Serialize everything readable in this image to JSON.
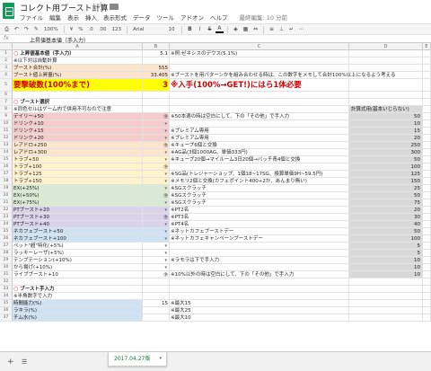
{
  "doc_title": "コレクト用ブースト計算",
  "menu": [
    "ファイル",
    "編集",
    "表示",
    "挿入",
    "表示形式",
    "データ",
    "ツール",
    "アドオン",
    "ヘルプ"
  ],
  "last_edit": "最終編集: 10 分前",
  "toolbar": {
    "zoom": "100%",
    "currency": "¥",
    "percent": "%",
    "decimals1": ".0",
    "decimals2": ".00",
    "number_format": "123",
    "font": "Arial",
    "font_size": "10",
    "bold": "B",
    "italic": "I",
    "strike": "S",
    "color_a": "A"
  },
  "formula_bar": {
    "fx": "fx",
    "content": "上昇値基本値（手入力）"
  },
  "columns": [
    "A",
    "B",
    "C",
    "D",
    "E"
  ],
  "rows": [
    {
      "n": "1",
      "a": "上昇値基本値（手入力）",
      "b": "5.1",
      "c": "※例:ゼネシスのデウス(5.1%)",
      "d": "",
      "type": "head",
      "a_bg": "#ffffff",
      "marker": "○"
    },
    {
      "n": "2",
      "a": "※以下対は自動計算",
      "b": "",
      "c": "",
      "d": "",
      "a_bg": "#ffffff"
    },
    {
      "n": "3",
      "a": "ブースト合計(%)",
      "b": "555",
      "c": "",
      "d": "",
      "a_bg": "#fce5cd",
      "b_bg": "#fce5cd"
    },
    {
      "n": "4",
      "a": "ブースト値上昇量(%)",
      "b": "33.405",
      "c": "※ブーストを用パターンかを組み合わせる時は、この数字をメモして合計100%以上になるよう考える",
      "d": "",
      "a_bg": "#fce5cd",
      "b_bg": "#fce5cd"
    },
    {
      "n": "5",
      "a": "要撃破数(100%まで)",
      "b": "3",
      "c": "※入手(100%→GET!)にはら1体必要",
      "d": "",
      "tall": true,
      "big": true,
      "a_bg": "#ffff00",
      "b_bg": "#ffff00"
    },
    {
      "n": "6",
      "a": "",
      "b": "",
      "c": "",
      "d": ""
    },
    {
      "n": "7",
      "a": "ブースト選択",
      "b": "",
      "c": "",
      "d": "",
      "type": "head",
      "marker": "○"
    },
    {
      "n": "8",
      "a": "※同色セルはゲーム内で併用不可なので注意",
      "b": "",
      "c": "",
      "d": "計算式用(基本いじらない)",
      "d_bg": "#d9d9d9",
      "d_align": "left"
    },
    {
      "n": "9",
      "a": "デイリー+50",
      "b": "○",
      "c": "※50本適の時は空白にして、下の「その他」で手入力",
      "d": "50",
      "a_bg": "#f4cccc",
      "b_bg": "#f4cccc",
      "dd": true,
      "d_bg": "#d9d9d9"
    },
    {
      "n": "10",
      "a": "ドリンク+10",
      "b": "",
      "c": "",
      "d": "10",
      "a_bg": "#f4cccc",
      "b_bg": "#f4cccc",
      "dd": true,
      "d_bg": "#d9d9d9"
    },
    {
      "n": "11",
      "a": "ドリンク+15",
      "b": "",
      "c": "※プレミアム専用",
      "d": "15",
      "a_bg": "#f4cccc",
      "b_bg": "#f4cccc",
      "dd": true,
      "d_bg": "#d9d9d9"
    },
    {
      "n": "12",
      "a": "ドリンク+20",
      "b": "",
      "c": "※プレミアム専用",
      "d": "20",
      "a_bg": "#f4cccc",
      "b_bg": "#f4cccc",
      "dd": true,
      "d_bg": "#d9d9d9"
    },
    {
      "n": "13",
      "a": "レアドロ+250",
      "b": "○",
      "c": "※キューブ6個と交換",
      "d": "250",
      "a_bg": "#fce5cd",
      "b_bg": "#fce5cd",
      "dd": true,
      "d_bg": "#d9d9d9"
    },
    {
      "n": "14",
      "a": "レアドロ+300",
      "b": "",
      "c": "※AG品(3個1000AG、単価333円)",
      "d": "300",
      "a_bg": "#fce5cd",
      "b_bg": "#fce5cd",
      "dd": true,
      "d_bg": "#d9d9d9"
    },
    {
      "n": "15",
      "a": "トラブ+50",
      "b": "",
      "c": "※キューブ20個→マイルーム3日20個→バッチ青4個と交換",
      "d": "50",
      "a_bg": "#fff2cc",
      "b_bg": "#fff2cc",
      "dd": true,
      "d_bg": "#d9d9d9"
    },
    {
      "n": "16",
      "a": "トラブ+100",
      "b": "○",
      "c": "",
      "d": "100",
      "a_bg": "#fff2cc",
      "b_bg": "#fff2cc",
      "dd": true,
      "d_bg": "#d9d9d9"
    },
    {
      "n": "17",
      "a": "トラブ+125",
      "b": "",
      "c": "※SG品(トレジャーショップ、1個18~17SG、換算単価9H~59.5円)",
      "d": "125",
      "a_bg": "#fff2cc",
      "b_bg": "#fff2cc",
      "dd": true,
      "d_bg": "#d9d9d9"
    },
    {
      "n": "18",
      "a": "トラブ+150",
      "b": "",
      "c": "※メモリ2個と交換(カフェポイント400+2か、あんまり無い)",
      "d": "150",
      "a_bg": "#fff2cc",
      "b_bg": "#fff2cc",
      "dd": true,
      "d_bg": "#d9d9d9"
    },
    {
      "n": "19",
      "a": "EX(+25%)",
      "b": "",
      "c": "※SGスクラッチ",
      "d": "25",
      "a_bg": "#d9ead3",
      "b_bg": "#d9ead3",
      "dd": true,
      "d_bg": "#d9d9d9"
    },
    {
      "n": "20",
      "a": "EX(+50%)",
      "b": "○",
      "c": "※SGスクラッチ",
      "d": "50",
      "a_bg": "#d9ead3",
      "b_bg": "#d9ead3",
      "dd": true,
      "d_bg": "#d9d9d9"
    },
    {
      "n": "21",
      "a": "EX(+75%)",
      "b": "",
      "c": "※SGスクラッチ",
      "d": "75",
      "a_bg": "#d9ead3",
      "b_bg": "#d9ead3",
      "dd": true,
      "d_bg": "#d9d9d9"
    },
    {
      "n": "22",
      "a": "PTブースト+20",
      "b": "",
      "c": "※PT2名",
      "d": "20",
      "a_bg": "#d9d2e9",
      "b_bg": "#d9d2e9",
      "dd": true,
      "d_bg": "#d9d9d9"
    },
    {
      "n": "23",
      "a": "PTブースト+30",
      "b": "○",
      "c": "※PT3名",
      "d": "30",
      "a_bg": "#d9d2e9",
      "b_bg": "#d9d2e9",
      "dd": true,
      "d_bg": "#d9d9d9"
    },
    {
      "n": "24",
      "a": "PTブースト+40",
      "b": "",
      "c": "※PT4名",
      "d": "40",
      "a_bg": "#d9d2e9",
      "b_bg": "#d9d2e9",
      "dd": true,
      "d_bg": "#d9d9d9"
    },
    {
      "n": "25",
      "a": "ネカフェブースト+50",
      "b": "",
      "c": "※ネットカフェブーストデー",
      "d": "50",
      "a_bg": "#cfe2f3",
      "b_bg": "#cfe2f3",
      "dd": true,
      "d_bg": "#d9d9d9"
    },
    {
      "n": "26",
      "a": "ネカフェブースト+100",
      "b": "",
      "c": "※ネットカフェキャンペーンブーストデー",
      "d": "100",
      "a_bg": "#cfe2f3",
      "b_bg": "#cfe2f3",
      "dd": true,
      "d_bg": "#d9d9d9"
    },
    {
      "n": "27",
      "a": "ペット\"超\"特化(+5%)",
      "b": "",
      "c": "",
      "d": "5",
      "dd": true,
      "d_bg": "#d9d9d9"
    },
    {
      "n": "28",
      "a": "ラッキーレーザ(+5%)",
      "b": "",
      "c": "",
      "d": "5",
      "dd": true,
      "d_bg": "#d9d9d9"
    },
    {
      "n": "29",
      "a": "テンプテーション(+10%)",
      "b": "",
      "c": "※ラモラは下で手入力",
      "d": "10",
      "dd": true,
      "d_bg": "#d9d9d9"
    },
    {
      "n": "30",
      "a": "から揚げ(+10%)",
      "b": "",
      "c": "",
      "d": "10",
      "dd": true,
      "d_bg": "#d9d9d9"
    },
    {
      "n": "31",
      "a": "ライブブースト+10",
      "b": "○",
      "c": "※10%以外の時は空白にして、下の「その他」で手入力",
      "d": "10",
      "dd": true,
      "d_bg": "#d9d9d9"
    },
    {
      "n": "32",
      "a": "",
      "b": "",
      "c": "",
      "d": ""
    },
    {
      "n": "33",
      "a": "ブースト手入力",
      "b": "",
      "c": "",
      "d": "",
      "type": "head",
      "marker": "○"
    },
    {
      "n": "34",
      "a": "※半角数字で入力",
      "b": "",
      "c": "",
      "d": ""
    },
    {
      "n": "35",
      "a": "時間能力(%)",
      "b": "15",
      "c": "※最大15",
      "d": "",
      "a_bg": "#cfe2f3"
    },
    {
      "n": "36",
      "a": "ラキラ(%)",
      "b": "",
      "c": "※最大25",
      "d": "",
      "a_bg": "#cfe2f3"
    },
    {
      "n": "37",
      "a": "チム水(%)",
      "b": "",
      "c": "※最大10",
      "d": "",
      "a_bg": "#cfe2f3"
    }
  ],
  "sheet_tab": "2017.04.27版",
  "add_sheet_icon": "plus-icon",
  "list_sheets_icon": "hamburger-icon"
}
